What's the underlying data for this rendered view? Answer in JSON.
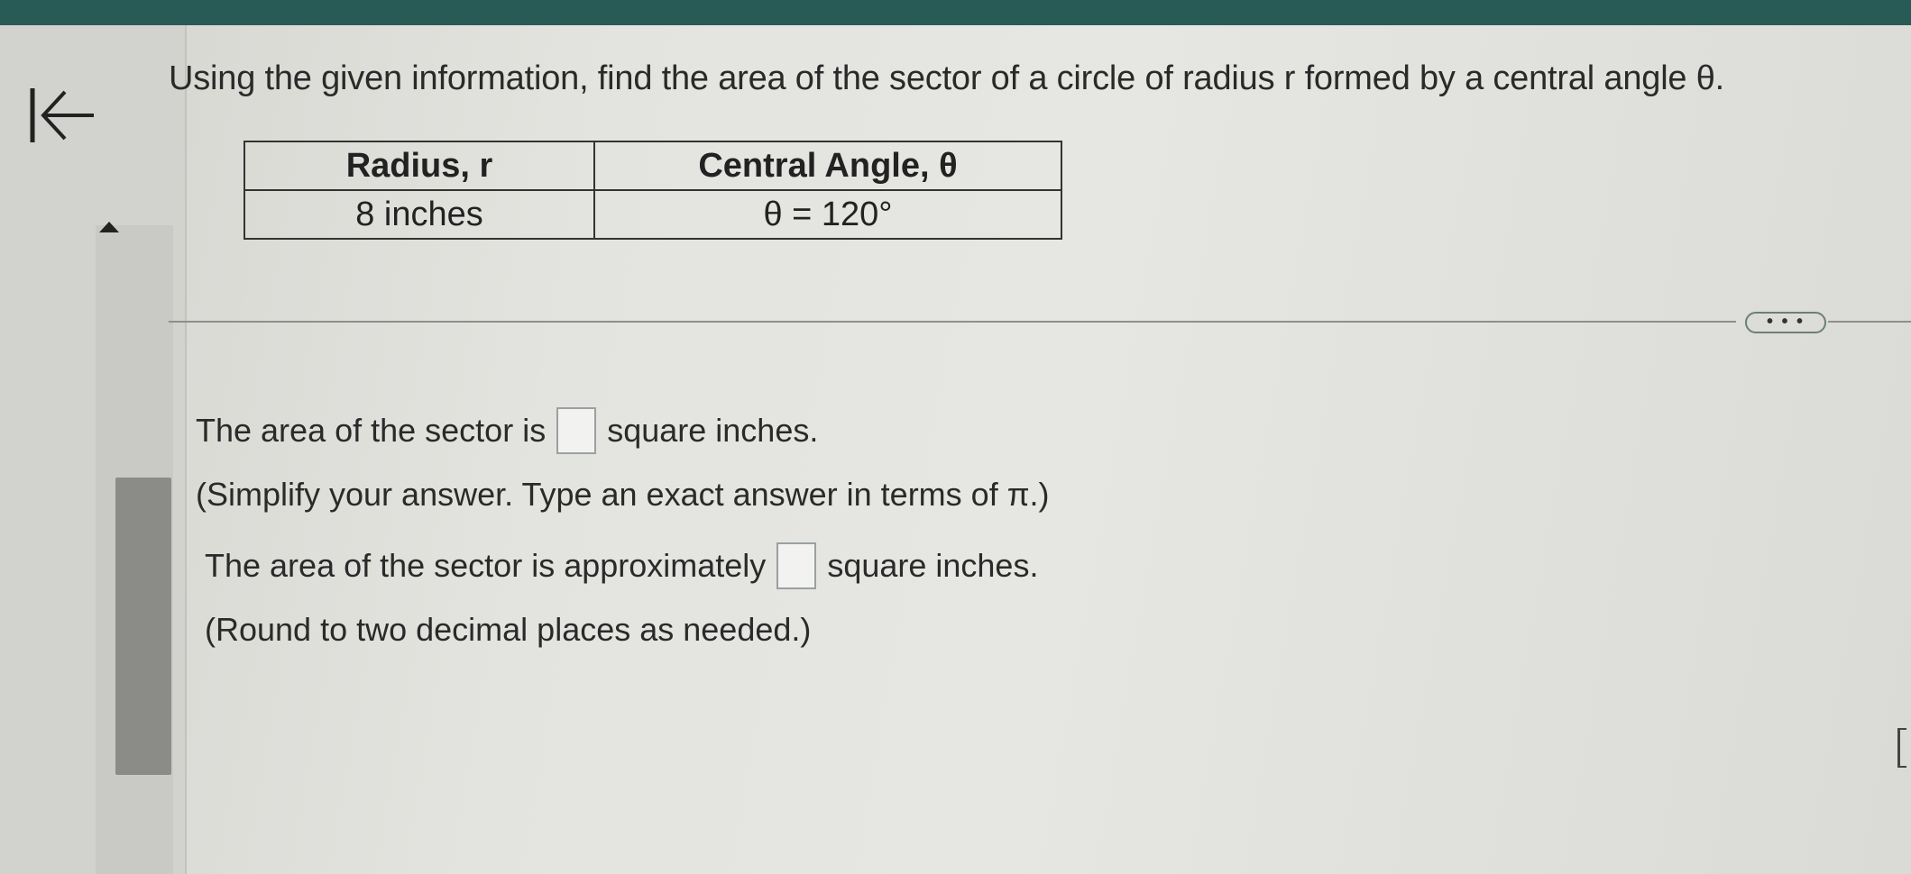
{
  "question": {
    "text": "Using the given information, find the area of the sector of a circle of radius r formed by a central angle θ."
  },
  "table": {
    "headers": [
      "Radius, r",
      "Central Angle, θ"
    ],
    "rows": [
      [
        "8 inches",
        "θ = 120°"
      ]
    ]
  },
  "more_button_label": "• • •",
  "answer1": {
    "prefix": "The area of the sector is",
    "suffix": "square inches.",
    "value": "",
    "hint": "(Simplify your answer. Type an exact answer in terms of π.)"
  },
  "answer2": {
    "prefix": "The area of the sector is approximately",
    "suffix": "square inches.",
    "value": "",
    "hint": "(Round to two decimal places as needed.)"
  },
  "icons": {
    "back": "collapse-left-icon",
    "scroll_up": "triangle-up-icon"
  },
  "colors": {
    "top_bar": "#285b55",
    "background": "#e3e3df",
    "text": "#2a2a2a"
  }
}
